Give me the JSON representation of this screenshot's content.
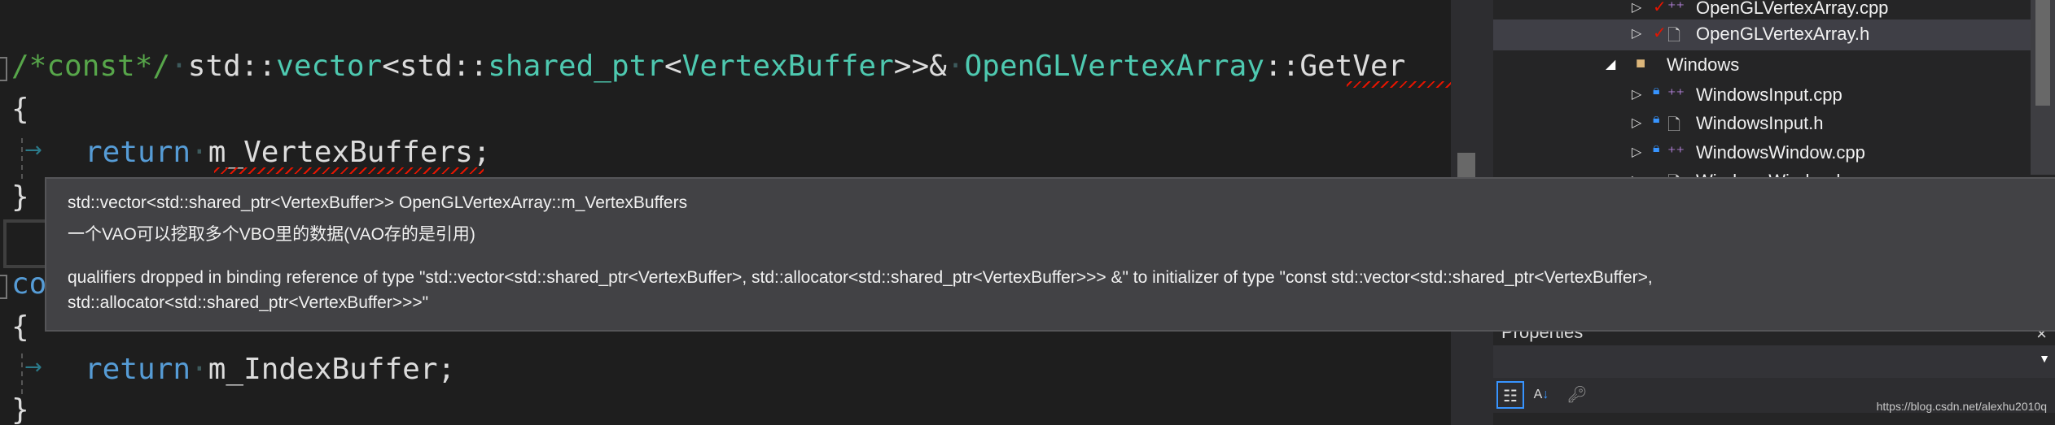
{
  "editor": {
    "lines": {
      "l1": {
        "comment": "/*const*/",
        "ns1": "std::",
        "vector": "vector",
        "lt1": "<std::",
        "shared": "shared_ptr",
        "lt2": "<",
        "vb": "VertexBuffer",
        "amp": ">>&",
        "cls": "OpenGLVertexArray",
        "sep": "::",
        "fn": "GetVer"
      },
      "l2": "{",
      "l3": {
        "kw": "return",
        "ident": "m_VertexBuffers;"
      },
      "l4": "}",
      "l5": "co",
      "l6": "{",
      "l7": {
        "kw": "return",
        "ident": "m_IndexBuffer;"
      },
      "l8": "}"
    },
    "whitespace_dot": "·",
    "tab_arrow": "→"
  },
  "tooltip": {
    "signature": "std::vector<std::shared_ptr<VertexBuffer>> OpenGLVertexArray::m_VertexBuffers",
    "comment": "一个VAO可以挖取多个VBO里的数据(VAO存的是引用)",
    "error_line1": "qualifiers dropped in binding reference of type \"std::vector<std::shared_ptr<VertexBuffer>, std::allocator<std::shared_ptr<VertexBuffer>>> &\" to initializer of type \"const std::vector<std::shared_ptr<VertexBuffer>,",
    "error_line2": "std::allocator<std::shared_ptr<VertexBuffer>>>\""
  },
  "solution_explorer": {
    "items": [
      {
        "label": "OpenGLVertexArray.cpp",
        "status": "checked-out",
        "type": "cpp"
      },
      {
        "label": "OpenGLVertexArray.h",
        "status": "checked-out",
        "type": "h",
        "selected": true
      },
      {
        "label": "Windows",
        "type": "folder",
        "expanded": true
      },
      {
        "label": "WindowsInput.cpp",
        "status": "locked",
        "type": "cpp"
      },
      {
        "label": "WindowsInput.h",
        "status": "locked",
        "type": "h"
      },
      {
        "label": "WindowsWindow.cpp",
        "status": "locked",
        "type": "cpp"
      },
      {
        "label": "WindowsWindow.h",
        "status": "locked",
        "type": "h"
      }
    ]
  },
  "properties": {
    "title": "Properties",
    "toolbar": [
      "categorized-icon",
      "alphabetical-icon",
      "property-pages-icon"
    ]
  },
  "watermark": "https://blog.csdn.net/alexhu2010q",
  "colors": {
    "comment": "#57a64a",
    "keyword": "#569cd6",
    "type": "#4ec9b0",
    "error": "#e51400",
    "tooltip_bg": "#424245"
  }
}
